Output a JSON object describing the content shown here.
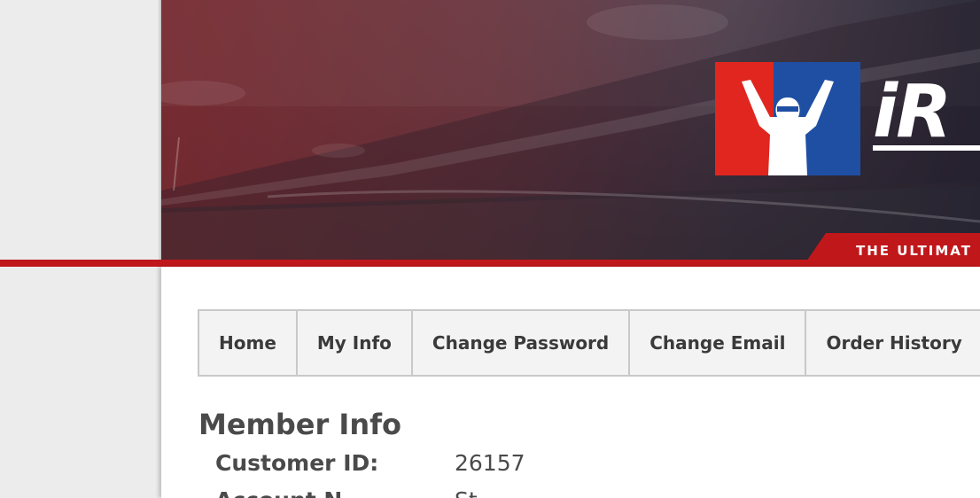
{
  "banner": {
    "brand_text": "iR",
    "tagline": "THE ULTIMAT",
    "colors": {
      "accent_red": "#c0171b",
      "logo_blue": "#1f4fa3",
      "logo_red": "#e0261f"
    }
  },
  "nav": {
    "items": [
      {
        "label": "Home"
      },
      {
        "label": "My Info"
      },
      {
        "label": "Change Password"
      },
      {
        "label": "Change Email"
      },
      {
        "label": "Order History"
      }
    ]
  },
  "member_info": {
    "title": "Member Info",
    "fields": [
      {
        "label": "Customer ID:",
        "value": "26157"
      },
      {
        "label": "Account N",
        "value": "St"
      }
    ]
  }
}
